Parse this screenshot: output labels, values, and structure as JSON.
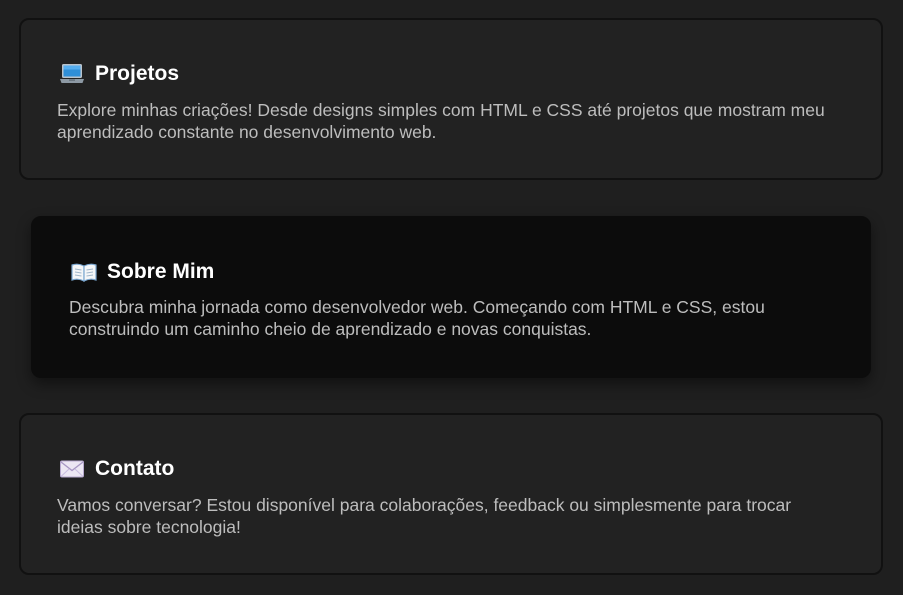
{
  "cards": [
    {
      "icon": "laptop-icon",
      "title": "Projetos",
      "text": "Explore minhas criações! Desde designs simples com HTML e CSS até projetos que mostram meu aprendizado constante no desenvolvimento web."
    },
    {
      "icon": "open-book-icon",
      "title": "Sobre Mim",
      "text": "Descubra minha jornada como desenvolvedor web. Começando com HTML e CSS, estou construindo um caminho cheio de aprendizado e novas conquistas."
    },
    {
      "icon": "envelope-icon",
      "title": "Contato",
      "text": "Vamos conversar? Estou disponível para colaborações, feedback ou simplesmente para trocar ideias sobre tecnologia!"
    }
  ],
  "colors": {
    "background": "#1f1f1f",
    "card": "#222222",
    "card_active": "#0c0c0c",
    "title": "#ffffff",
    "text": "#bdbdbd"
  }
}
